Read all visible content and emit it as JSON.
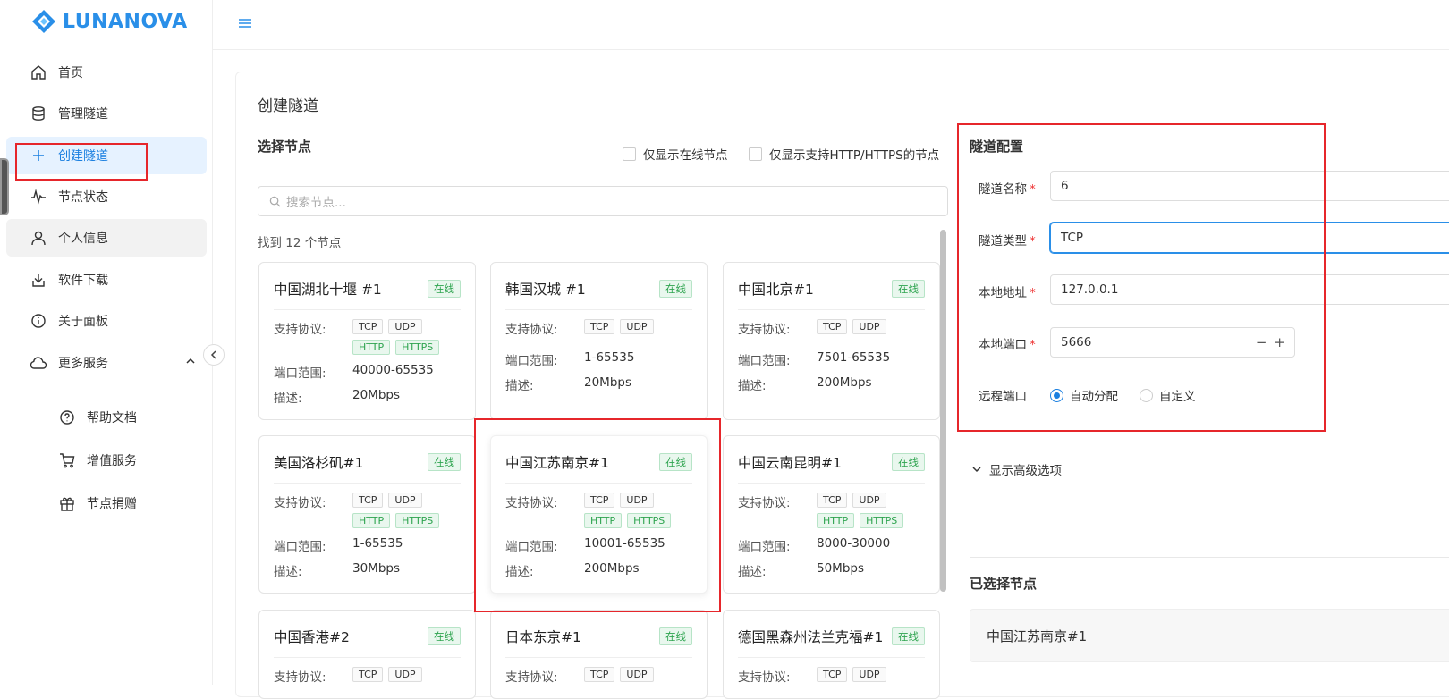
{
  "brand": {
    "name": "LUNANOVA"
  },
  "sidebar": {
    "items": [
      {
        "label": "首页",
        "icon": "home-icon"
      },
      {
        "label": "管理隧道",
        "icon": "database-icon"
      },
      {
        "label": "创建隧道",
        "icon": "plus-icon"
      },
      {
        "label": "节点状态",
        "icon": "pulse-icon"
      },
      {
        "label": "个人信息",
        "icon": "user-icon"
      },
      {
        "label": "软件下载",
        "icon": "download-icon"
      },
      {
        "label": "关于面板",
        "icon": "info-icon"
      },
      {
        "label": "更多服务",
        "icon": "cloud-icon"
      }
    ],
    "sub_items": [
      {
        "label": "帮助文档",
        "icon": "help-icon"
      },
      {
        "label": "增值服务",
        "icon": "cart-icon"
      },
      {
        "label": "节点捐赠",
        "icon": "gift-icon"
      }
    ]
  },
  "page": {
    "title": "创建隧道"
  },
  "node_select": {
    "title": "选择节点",
    "filter_online": "仅显示在线节点",
    "filter_http": "仅显示支持HTTP/HTTPS的节点",
    "search_placeholder": "搜索节点...",
    "found_text": "找到 12 个节点",
    "labels": {
      "protocol": "支持协议:",
      "ports": "端口范围:",
      "desc": "描述:"
    },
    "nodes": [
      {
        "name": "中国湖北十堰 #1",
        "status": "在线",
        "protocols": [
          "TCP",
          "UDP",
          "HTTP",
          "HTTPS"
        ],
        "ports": "40000-65535",
        "desc": "20Mbps"
      },
      {
        "name": "韩国汉城 #1",
        "status": "在线",
        "protocols": [
          "TCP",
          "UDP"
        ],
        "ports": "1-65535",
        "desc": "20Mbps"
      },
      {
        "name": "中国北京#1",
        "status": "在线",
        "protocols": [
          "TCP",
          "UDP"
        ],
        "ports": "7501-65535",
        "desc": "200Mbps"
      },
      {
        "name": "美国洛杉矶#1",
        "status": "在线",
        "protocols": [
          "TCP",
          "UDP",
          "HTTP",
          "HTTPS"
        ],
        "ports": "1-65535",
        "desc": "30Mbps"
      },
      {
        "name": "中国江苏南京#1",
        "status": "在线",
        "protocols": [
          "TCP",
          "UDP",
          "HTTP",
          "HTTPS"
        ],
        "ports": "10001-65535",
        "desc": "200Mbps"
      },
      {
        "name": "中国云南昆明#1",
        "status": "在线",
        "protocols": [
          "TCP",
          "UDP",
          "HTTP",
          "HTTPS"
        ],
        "ports": "8000-30000",
        "desc": "50Mbps"
      },
      {
        "name": "中国香港#2",
        "status": "在线",
        "protocols": [
          "TCP",
          "UDP"
        ]
      },
      {
        "name": "日本东京#1",
        "status": "在线",
        "protocols": [
          "TCP",
          "UDP"
        ]
      },
      {
        "name": "德国黑森州法兰克福#1",
        "status": "在线",
        "protocols": [
          "TCP",
          "UDP"
        ]
      }
    ]
  },
  "tunnel_config": {
    "title": "隧道配置",
    "name_label": "隧道名称",
    "name_value": "6",
    "type_label": "隧道类型",
    "type_value": "TCP",
    "local_addr_label": "本地地址",
    "local_addr_value": "127.0.0.1",
    "local_port_label": "本地端口",
    "local_port_value": "5666",
    "remote_port_label": "远程端口",
    "remote_auto": "自动分配",
    "remote_custom": "自定义",
    "advanced": "显示高级选项"
  },
  "selected_node": {
    "title": "已选择节点",
    "value": "中国江苏南京#1"
  }
}
